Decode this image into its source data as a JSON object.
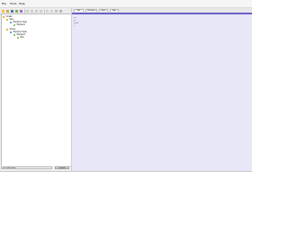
{
  "menubar": {
    "items": [
      "File",
      "Tools",
      "Help"
    ]
  },
  "tree": {
    "items": [
      {
        "label": "Ocean"
      },
      {
        "label": "Sea"
      },
      {
        "label": "Explorer View"
      },
      {
        "label": "Element"
      },
      {
        "label": "Shore"
      },
      {
        "label": "Explorer View"
      },
      {
        "label": "Element"
      },
      {
        "label": "Box"
      }
    ]
  },
  "statusbar": {
    "input_value": "sr 5 selections",
    "button_label": "Launch"
  },
  "tabs": {
    "items": [
      "Edit",
      "Preview",
      "Save",
      "Run"
    ]
  },
  "content": {
    "lines": [
      "x=",
      "a{",
      "  kd=4",
      "  }"
    ]
  }
}
